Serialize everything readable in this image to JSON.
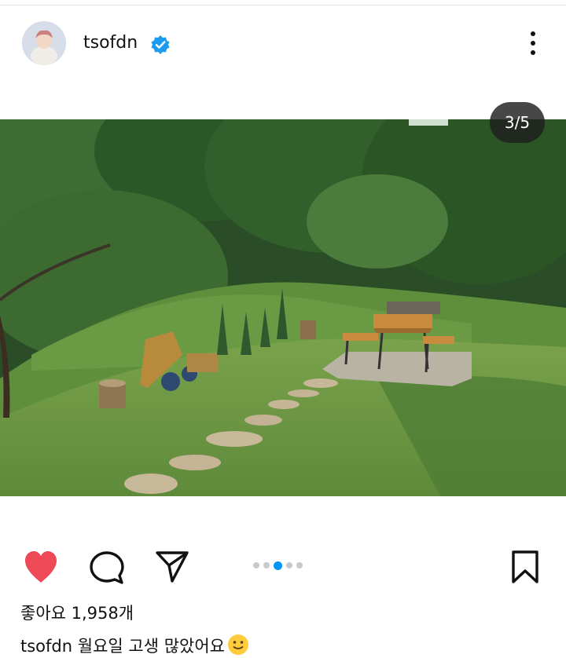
{
  "post": {
    "username": "tsofdn",
    "verified": true,
    "image_counter": "3/5",
    "current_image": 3,
    "total_images": 5,
    "likes_text": "좋아요 1,958개",
    "caption_text": "월요일 고생 많았어요",
    "caption_emoji": "slightly-smiling-face-icon"
  },
  "colors": {
    "like_red": "#ed4956",
    "active_dot_blue": "#0095f6",
    "verified_blue": "#1d9bf0"
  },
  "icons": {
    "header": [
      "verified-badge-icon",
      "more-options-icon"
    ],
    "actions": [
      "heart-icon",
      "comment-icon",
      "share-icon",
      "bookmark-icon"
    ]
  }
}
